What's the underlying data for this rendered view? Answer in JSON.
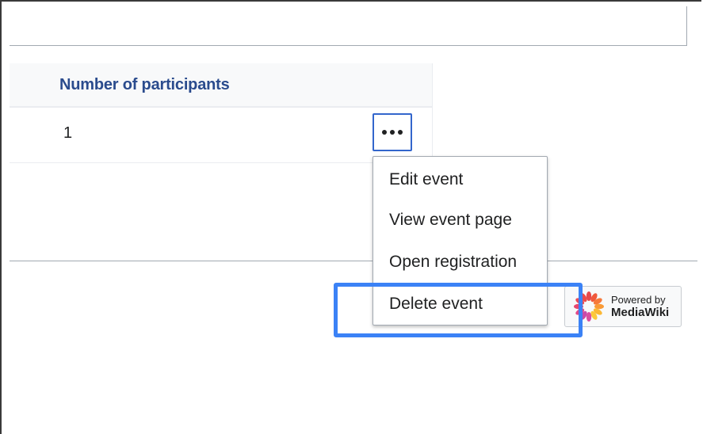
{
  "table": {
    "column_header": "Number of participants",
    "rows": [
      {
        "participants": "1"
      }
    ]
  },
  "row_menu": {
    "toggle_icon": "ellipsis-icon",
    "items": [
      {
        "label": "Edit event"
      },
      {
        "label": "View event page"
      },
      {
        "label": "Open registration"
      },
      {
        "label": "Delete event"
      }
    ]
  },
  "footer": {
    "powered_badge": {
      "line1": "Powered by",
      "line2": "MediaWiki",
      "icon": "mediawiki-logo-icon"
    }
  },
  "colors": {
    "header_link": "#2a4b8d",
    "focus_border": "#3366cc",
    "highlight": "#3b82f6"
  }
}
